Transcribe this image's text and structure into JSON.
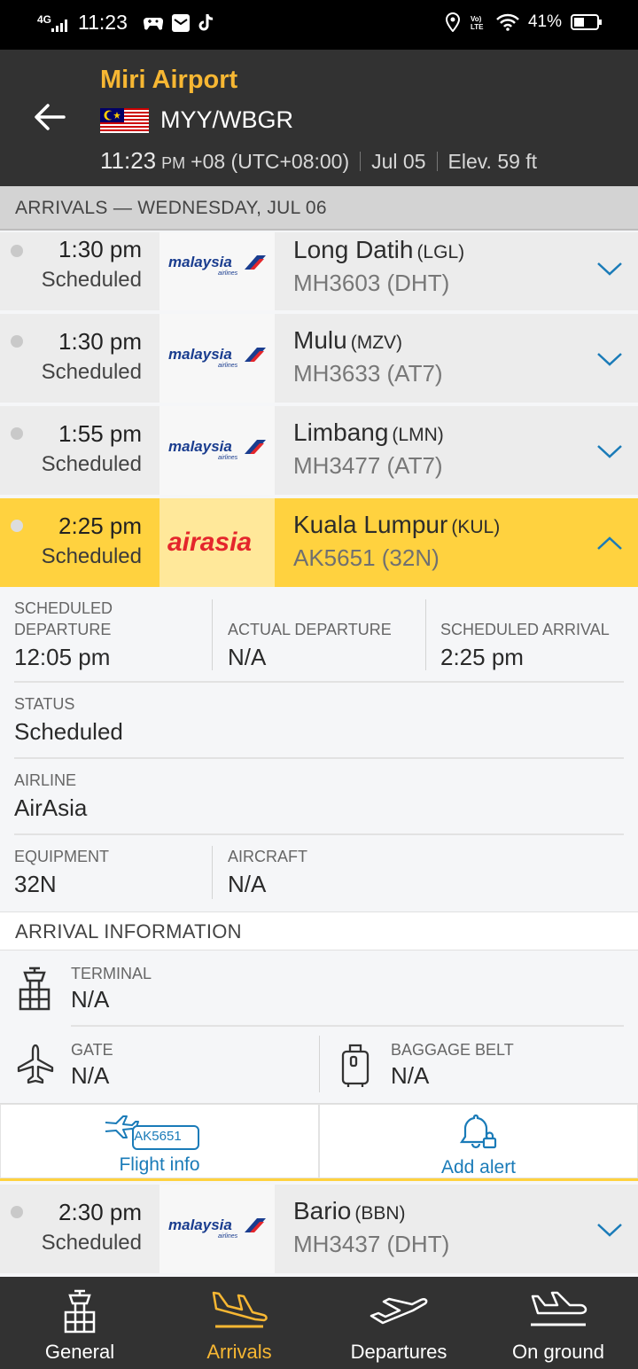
{
  "status_bar": {
    "network": "4G",
    "time": "11:23",
    "battery": "41%",
    "icons": [
      "gamepad-icon",
      "mail-icon",
      "tiktok-icon",
      "location-icon",
      "volte-icon",
      "wifi-icon",
      "battery-icon"
    ]
  },
  "header": {
    "airport_name": "Miri Airport",
    "codes": "MYY/WBGR",
    "local_time": "11:23",
    "ampm": "PM",
    "timezone": "+08 (UTC+08:00)",
    "date": "Jul 05",
    "elevation": "Elev. 59 ft"
  },
  "section": {
    "title": "ARRIVALS — WEDNESDAY, JUL 06"
  },
  "flights": [
    {
      "time": "1:30 pm",
      "status": "Scheduled",
      "airline": "malaysia",
      "dest": "Long Datih",
      "dest_code": "(LGL)",
      "flight": "MH3603 (DHT)"
    },
    {
      "time": "1:30 pm",
      "status": "Scheduled",
      "airline": "malaysia",
      "dest": "Mulu",
      "dest_code": "(MZV)",
      "flight": "MH3633 (AT7)"
    },
    {
      "time": "1:55 pm",
      "status": "Scheduled",
      "airline": "malaysia",
      "dest": "Limbang",
      "dest_code": "(LMN)",
      "flight": "MH3477 (AT7)"
    },
    {
      "time": "2:25 pm",
      "status": "Scheduled",
      "airline": "airasia",
      "dest": "Kuala Lumpur",
      "dest_code": "(KUL)",
      "flight": "AK5651 (32N)"
    },
    {
      "time": "2:30 pm",
      "status": "Scheduled",
      "airline": "malaysia",
      "dest": "Bario",
      "dest_code": "(BBN)",
      "flight": "MH3437 (DHT)"
    }
  ],
  "logos": {
    "malaysia_main": "malaysia",
    "malaysia_sub": "airlines",
    "airasia": "airasia"
  },
  "details": {
    "sched_dep_label_1": "SCHEDULED",
    "sched_dep_label_2": "DEPARTURE",
    "sched_dep_value": "12:05 pm",
    "actual_dep_label": "ACTUAL DEPARTURE",
    "actual_dep_value": "N/A",
    "sched_arr_label": "SCHEDULED ARRIVAL",
    "sched_arr_value": "2:25 pm",
    "status_label": "STATUS",
    "status_value": "Scheduled",
    "airline_label": "AIRLINE",
    "airline_value": "AirAsia",
    "equipment_label": "EQUIPMENT",
    "equipment_value": "32N",
    "aircraft_label": "AIRCRAFT",
    "aircraft_value": "N/A"
  },
  "arrival_info": {
    "title": "ARRIVAL INFORMATION",
    "terminal_label": "TERMINAL",
    "terminal_value": "N/A",
    "gate_label": "GATE",
    "gate_value": "N/A",
    "baggage_label": "BAGGAGE BELT",
    "baggage_value": "N/A"
  },
  "actions": {
    "flight_badge": "AK5651",
    "flight_info": "Flight info",
    "add_alert": "Add alert"
  },
  "nav": {
    "general": "General",
    "arrivals": "Arrivals",
    "departures": "Departures",
    "on_ground": "On ground"
  },
  "colors": {
    "accent": "#f7b733",
    "highlight": "#ffd23f",
    "link": "#1a7bb8",
    "header_bg": "#323232",
    "airasia_red": "#e4262c",
    "mas_blue": "#1a3d8f"
  }
}
